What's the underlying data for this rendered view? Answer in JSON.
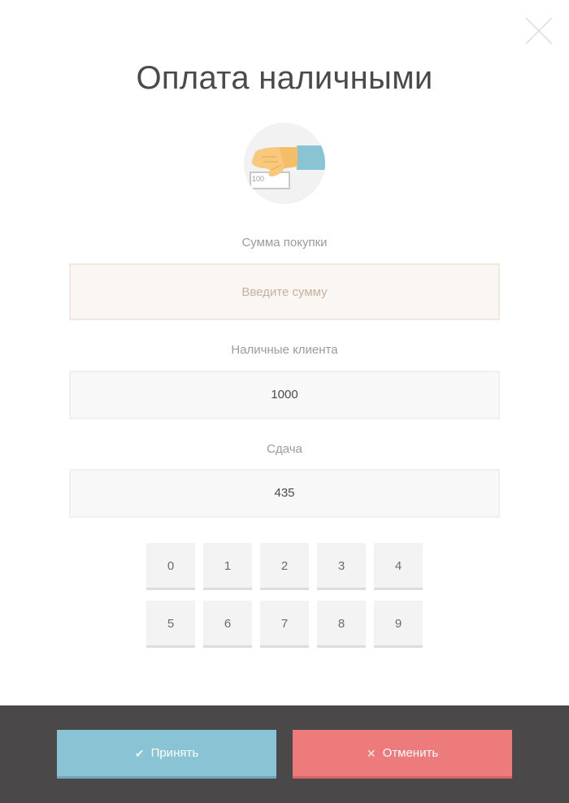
{
  "dialog": {
    "title": "Оплата наличными",
    "close_icon": "close-icon"
  },
  "illustration": {
    "icon": "hand-with-banknote-icon",
    "banknote_label": "100",
    "colors": {
      "circle": "#f2f2f2",
      "skin": "#f8c97c",
      "sleeve": "#8ac4d4"
    }
  },
  "purchase_amount": {
    "label": "Сумма покупки",
    "value": "",
    "placeholder": "Введите сумму"
  },
  "client_cash": {
    "label": "Наличные клиента",
    "value": "1000"
  },
  "change": {
    "label": "Сдача",
    "value": "435"
  },
  "keypad": {
    "keys": [
      "0",
      "1",
      "2",
      "3",
      "4",
      "5",
      "6",
      "7",
      "8",
      "9"
    ]
  },
  "footer": {
    "accept_label": "Принять",
    "accept_icon": "checkmark-icon",
    "cancel_label": "Отменить",
    "cancel_icon": "cross-icon",
    "colors": {
      "background": "#4a4848",
      "accept": "#8ac4d4",
      "cancel": "#ee7b7b"
    }
  }
}
